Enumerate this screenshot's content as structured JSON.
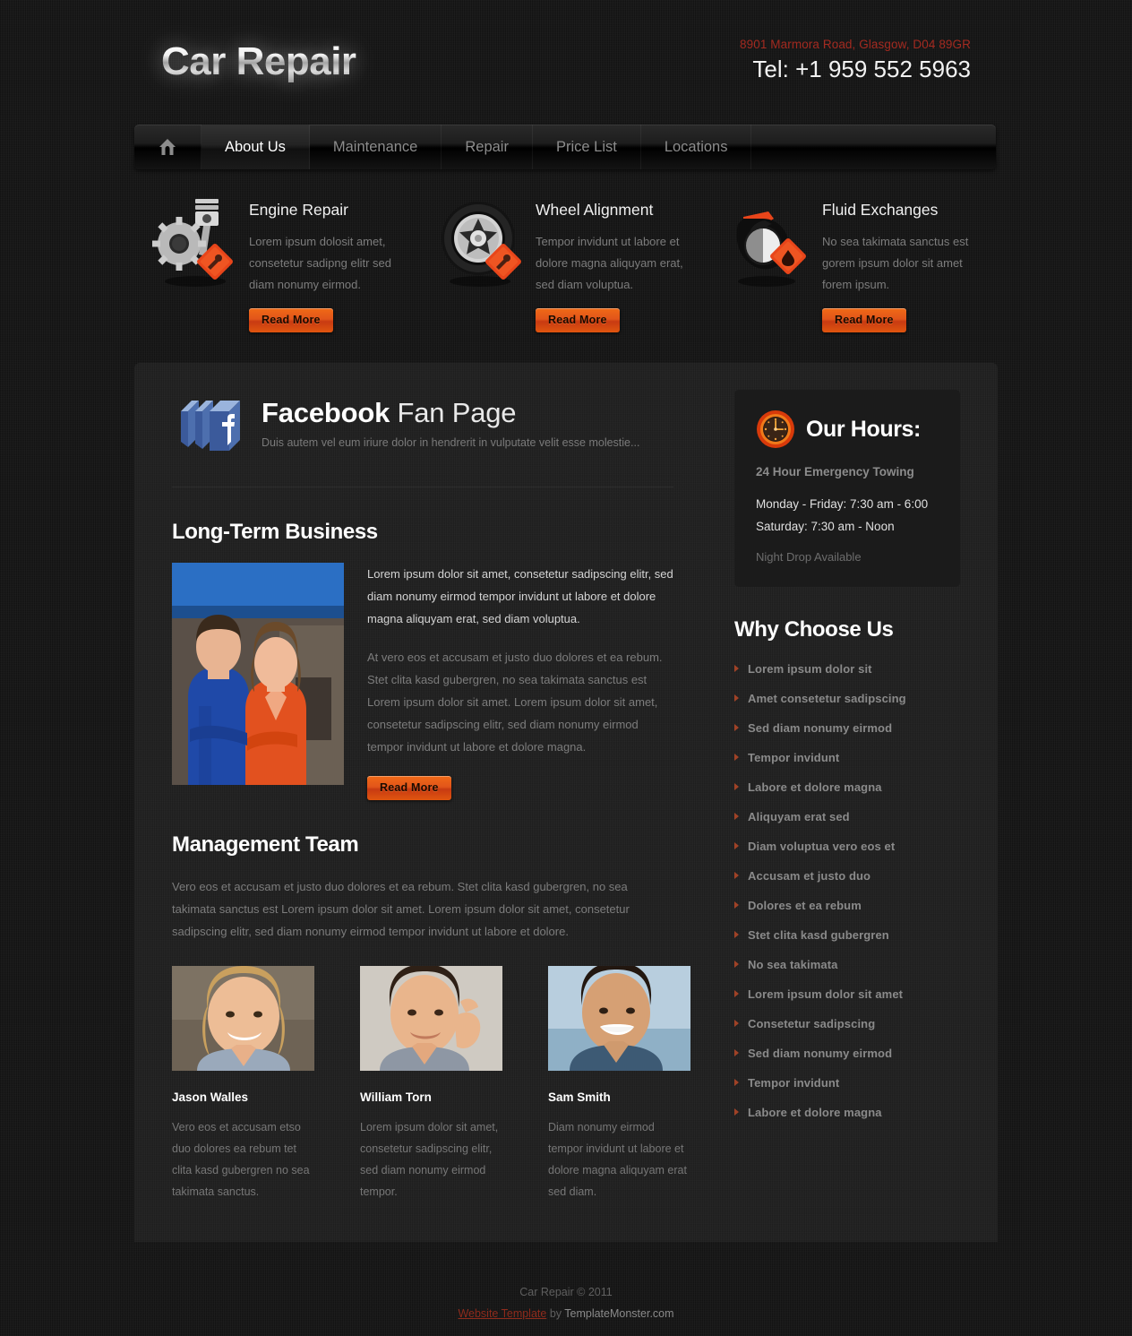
{
  "header": {
    "logo": "Car Repair",
    "address": "8901 Marmora Road, Glasgow, D04 89GR",
    "tel": "Tel: +1 959 552 5963",
    "address_color": "#a32a20"
  },
  "nav": {
    "home_icon": "home-icon",
    "items": [
      {
        "label": "About Us",
        "active": true
      },
      {
        "label": "Maintenance",
        "active": false
      },
      {
        "label": "Repair",
        "active": false
      },
      {
        "label": "Price List",
        "active": false
      },
      {
        "label": "Locations",
        "active": false
      }
    ]
  },
  "services": [
    {
      "icon": "engine-piston-gear-icon",
      "title": "Engine Repair",
      "text": "Lorem ipsum dolosit amet, consetetur sadipng elitr sed diam nonumy eirmod.",
      "button": "Read More"
    },
    {
      "icon": "wheel-tire-icon",
      "title": "Wheel Alignment",
      "text": "Tempor invidunt ut labore et dolore magna aliquyam erat, sed diam voluptua.",
      "button": "Read More"
    },
    {
      "icon": "oil-can-fluid-icon",
      "title": "Fluid Exchanges",
      "text": "No sea takimata sanctus est gorem ipsum dolor sit amet forem ipsum.",
      "button": "Read More"
    }
  ],
  "facebook": {
    "icon": "facebook-icon",
    "title_bold": "Facebook",
    "title_rest": " Fan Page",
    "subtitle": "Duis autem vel eum iriure dolor in hendrerit in vulputate velit esse molestie..."
  },
  "long_term": {
    "title": "Long-Term Business",
    "photo": "mechanic-couple-photo",
    "paragraph1": "Lorem ipsum dolor sit amet, consetetur sadipscing elitr, sed diam nonumy eirmod tempor invidunt ut labore et dolore magna aliquyam erat, sed diam voluptua.",
    "paragraph2": "At vero eos et accusam et justo duo dolores et ea rebum. Stet clita kasd gubergren, no sea takimata sanctus est Lorem ipsum dolor sit amet. Lorem ipsum dolor sit amet, consetetur sadipscing elitr, sed diam nonumy eirmod tempor invidunt ut labore et dolore magna.",
    "button": "Read More"
  },
  "management": {
    "title": "Management Team",
    "intro": "Vero eos et accusam et justo duo dolores et ea rebum. Stet clita kasd gubergren, no sea takimata sanctus est Lorem ipsum dolor sit amet. Lorem ipsum dolor sit amet, consetetur sadipscing elitr, sed diam nonumy eirmod tempor invidunt ut labore et dolore.",
    "members": [
      {
        "photo": "jason-walles-photo",
        "name": "Jason Walles",
        "desc": "Vero eos et accusam etso duo dolores ea rebum tet clita kasd gubergren no sea takimata sanctus."
      },
      {
        "photo": "william-torn-photo",
        "name": "William Torn",
        "desc": "Lorem ipsum dolor sit amet, consetetur sadipscing elitr, sed diam nonumy eirmod tempor."
      },
      {
        "photo": "sam-smith-photo",
        "name": "Sam Smith",
        "desc": "Diam nonumy eirmod tempor invidunt ut labore et dolore magna aliquyam erat sed diam."
      }
    ]
  },
  "hours": {
    "icon": "clock-icon",
    "title": "Our Hours:",
    "emphasis": "24 Hour Emergency Towing",
    "line1": "Monday - Friday: 7:30 am - 6:00",
    "line2": "Saturday: 7:30 am - Noon",
    "note": "Night Drop Available"
  },
  "why_choose": {
    "title": "Why Choose Us",
    "items": [
      "Lorem ipsum dolor sit",
      "Amet consetetur sadipscing",
      "Sed diam nonumy eirmod",
      "Tempor invidunt",
      "Labore et dolore magna",
      "Aliquyam erat sed",
      "Diam voluptua vero eos et",
      "Accusam et justo duo",
      "Dolores et ea rebum",
      "Stet clita kasd gubergren",
      "No sea takimata",
      "Lorem ipsum dolor sit amet",
      "Consetetur sadipscing",
      "Sed diam nonumy eirmod",
      "Tempor invidunt",
      "Labore et dolore magna"
    ],
    "bullet_color": "#a04226"
  },
  "footer": {
    "copyright": "Car Repair © 2011",
    "link": "Website Template",
    "by": " by ",
    "provider": "TemplateMonster.com"
  }
}
